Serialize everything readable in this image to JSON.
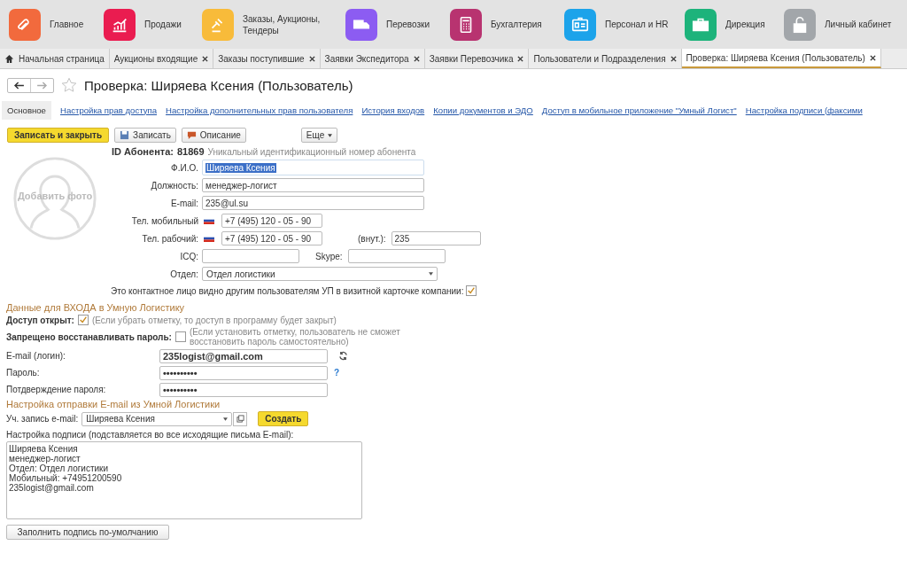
{
  "sections": [
    {
      "label": "Главное",
      "kind": "home",
      "color": "#f26a3d"
    },
    {
      "label": "Продажи",
      "kind": "chart",
      "color": "#ea1c50"
    },
    {
      "label": "Заказы,  Аукционы, Тендеры",
      "kind": "gavel",
      "color": "#f8bb3a"
    },
    {
      "label": "Перевозки",
      "kind": "truck",
      "color": "#8c5cf2"
    },
    {
      "label": "Бухгалтерия",
      "kind": "calc",
      "color": "#b83370"
    },
    {
      "label": "Персонал и HR",
      "kind": "badge",
      "color": "#1ca3ea"
    },
    {
      "label": "Дирекция",
      "kind": "briefcase",
      "color": "#1db37b"
    },
    {
      "label": "Личный кабинет",
      "kind": "lock",
      "color": "#a2a6aa"
    }
  ],
  "tabs": [
    {
      "label": "Начальная страница",
      "kind": "home",
      "selected": false
    },
    {
      "label": "Аукционы входящие",
      "kind": "closable",
      "selected": false
    },
    {
      "label": "Заказы поступившие",
      "kind": "closable",
      "selected": false
    },
    {
      "label": "Заявки Экспедитора",
      "kind": "closable",
      "selected": false
    },
    {
      "label": "Заявки Перевозчика",
      "kind": "closable",
      "selected": false
    },
    {
      "label": "Пользователи и Подразделения",
      "kind": "closable",
      "selected": false
    },
    {
      "label": "Проверка: Ширяева Ксения (Пользователь)",
      "kind": "closable",
      "selected": true
    }
  ],
  "title": "Проверка: Ширяева Ксения (Пользователь)",
  "form_tabs": [
    {
      "label": "Основное",
      "selected": true
    },
    {
      "label": "Настройка прав доступа",
      "selected": false
    },
    {
      "label": "Настройка дополнительных прав пользователя",
      "selected": false
    },
    {
      "label": "История входов",
      "selected": false
    },
    {
      "label": "Копии документов и ЭДО",
      "selected": false
    },
    {
      "label": "Доступ в мобильное приложение \"Умный Логист\"",
      "selected": false
    },
    {
      "label": "Настройка подписи (факсими",
      "selected": false
    }
  ],
  "toolbar": [
    {
      "label": "Записать и закрыть",
      "kind": "primary"
    },
    {
      "label": "Записать",
      "kind": "save"
    },
    {
      "label": "Описание",
      "kind": "comment"
    },
    {
      "label": "Еще",
      "kind": "more"
    }
  ],
  "photo": {
    "label": "Добавить фото"
  },
  "subscriber": {
    "label": "ID Абонента:",
    "value": "81869",
    "hint": "Уникальный идентификационный номер абонента"
  },
  "fio": {
    "label": "Ф.И.О.",
    "value": "Ширяева Ксения"
  },
  "position": {
    "label": "Должность:",
    "value": "менеджер-логист"
  },
  "email": {
    "label": "E-mail:",
    "value": "235@ul.su"
  },
  "phone_mobile": {
    "label": "Тел. мобильный",
    "value": "+7 (495) 120 - 05 - 90"
  },
  "phone_work": {
    "label": "Тел. рабочий:",
    "value": "+7 (495) 120 - 05 - 90",
    "ext_label": "(внут.):",
    "ext_value": "235"
  },
  "icq": {
    "label": "ICQ:",
    "skype_label": "Skype:"
  },
  "department": {
    "label": "Отдел:",
    "value": "Отдел логистики"
  },
  "visible_contact": {
    "label": "Это контактное лицо видно другим пользователям УП в визитной карточке компании:",
    "checked": true
  },
  "login": {
    "heading": "Данные для ВХОДА в Умную Логистику",
    "access": {
      "label": "Доступ открыт:",
      "checked": true,
      "hint": "(Если убрать отметку, то доступ в программу будет закрыт)"
    },
    "no_restore": {
      "label": "Запрещено восстанавливать пароль:",
      "checked": false,
      "hint": "(Если установить отметку, пользователь не сможет восстановить пароль самостоятельно)"
    },
    "email": {
      "label": "E-mail (логин):",
      "value": "235logist@gmail.com"
    },
    "password": {
      "label": "Пароль:",
      "value": "••••••••••",
      "help": "?"
    },
    "confirm": {
      "label": "Потдверждение пароля:",
      "value": "••••••••••"
    }
  },
  "mail": {
    "heading": "Настройка отправки E-mail из Умной Логистики",
    "account": {
      "label": "Уч. запись e-mail:",
      "value": "Ширяева Ксения"
    },
    "create": "Создать",
    "signature_label": "Настройка подписи (подставляется во все исходящие письма E-mail):",
    "signature": [
      "Ширяева Ксения",
      "менеджер-логист",
      "Отдел: Отдел логистики",
      "Мобильный: +74951200590",
      "235logist@gmail.com"
    ],
    "fill_default": "Заполнить подпись по-умолчанию"
  }
}
